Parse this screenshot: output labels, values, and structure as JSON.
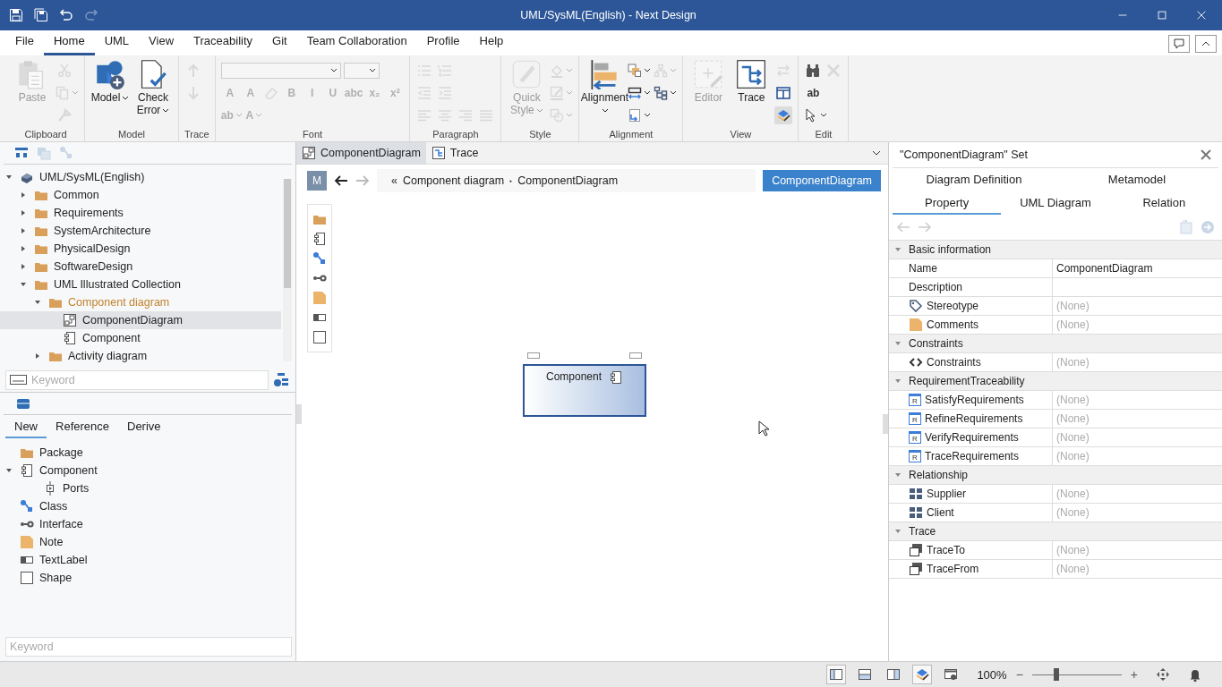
{
  "window": {
    "title": "UML/SysML(English) - Next Design"
  },
  "menu": [
    {
      "label": "File",
      "selected": false
    },
    {
      "label": "Home",
      "selected": true
    },
    {
      "label": "UML",
      "selected": false
    },
    {
      "label": "View",
      "selected": false
    },
    {
      "label": "Traceability",
      "selected": false
    },
    {
      "label": "Git",
      "selected": false
    },
    {
      "label": "Team Collaboration",
      "selected": false
    },
    {
      "label": "Profile",
      "selected": false
    },
    {
      "label": "Help",
      "selected": false
    }
  ],
  "ribbon": [
    {
      "label": "Clipboard",
      "large": [
        {
          "label": "Paste",
          "kind": "paste",
          "disabled": true,
          "menu": false
        }
      ],
      "rows": [
        [
          {
            "kind": "scissors",
            "disabled": true,
            "menu": false
          }
        ],
        [
          {
            "kind": "copy",
            "disabled": true,
            "menu": true
          }
        ],
        [
          {
            "kind": "brush",
            "disabled": true,
            "menu": false
          }
        ]
      ]
    },
    {
      "label": "Model",
      "large": [
        {
          "label": "Model",
          "kind": "model",
          "disabled": false,
          "menu": true
        },
        {
          "label": "Check Error",
          "kind": "check",
          "disabled": false,
          "menu": true
        }
      ]
    },
    {
      "label": "Trace",
      "rows": [
        [
          {
            "kind": "arrow-up",
            "disabled": true,
            "menu": false
          }
        ],
        [
          {
            "kind": "arrow-down",
            "disabled": true,
            "menu": false
          }
        ]
      ]
    },
    {
      "label": "Font",
      "rows": [
        [
          {
            "kind": "font-name-dropdown",
            "disabled": true,
            "menu": true
          },
          {
            "kind": "font-size-dropdown",
            "disabled": true,
            "menu": true
          }
        ],
        [
          {
            "kind": "grow",
            "glyph": "A",
            "disabled": true,
            "menu": false
          },
          {
            "kind": "shrink",
            "glyph": "A",
            "disabled": true,
            "menu": false
          },
          {
            "kind": "eraser",
            "disabled": true,
            "menu": false
          },
          {
            "kind": "bold",
            "glyph": "B",
            "disabled": true,
            "menu": false
          },
          {
            "kind": "italic",
            "glyph": "I",
            "disabled": true,
            "menu": false
          },
          {
            "kind": "underline",
            "glyph": "U",
            "disabled": true,
            "menu": false
          },
          {
            "kind": "strike",
            "glyph": "abc",
            "disabled": true,
            "menu": false
          },
          {
            "kind": "subscript",
            "glyph": "x₂",
            "disabled": true,
            "menu": false
          },
          {
            "kind": "superscript",
            "glyph": "x²",
            "disabled": true,
            "menu": false
          }
        ],
        [
          {
            "kind": "highlight",
            "glyph": "ab",
            "disabled": true,
            "menu": true
          },
          {
            "kind": "font-color",
            "glyph": "A",
            "disabled": true,
            "menu": true
          }
        ]
      ]
    },
    {
      "label": "Paragraph",
      "rows": [
        [
          {
            "kind": "bullets",
            "disabled": true,
            "menu": false
          },
          {
            "kind": "numbering",
            "disabled": true,
            "menu": false
          }
        ],
        [
          {
            "kind": "outdent",
            "disabled": true,
            "menu": false
          },
          {
            "kind": "indent",
            "disabled": true,
            "menu": false
          }
        ],
        [
          {
            "kind": "align-left",
            "disabled": true,
            "menu": false
          },
          {
            "kind": "align-center",
            "disabled": true,
            "menu": false
          },
          {
            "kind": "align-right",
            "disabled": true,
            "menu": false
          },
          {
            "kind": "justify",
            "disabled": true,
            "menu": false
          }
        ]
      ]
    },
    {
      "label": "Style",
      "large": [
        {
          "label": "Quick Style",
          "kind": "quick-style",
          "disabled": true,
          "menu": true
        }
      ],
      "rows": [
        [
          {
            "kind": "fill",
            "disabled": true,
            "menu": true
          }
        ],
        [
          {
            "kind": "pen",
            "disabled": true,
            "menu": true
          }
        ],
        [
          {
            "kind": "shapes",
            "disabled": true,
            "menu": true
          }
        ]
      ]
    },
    {
      "label": "Alignment",
      "large": [
        {
          "label": "Alignment",
          "kind": "alignment",
          "disabled": false,
          "menu": true
        }
      ],
      "rows": [
        [
          {
            "kind": "order",
            "disabled": false,
            "menu": true
          },
          {
            "kind": "hierarchy",
            "disabled": true,
            "menu": true
          }
        ],
        [
          {
            "kind": "spacing",
            "disabled": false,
            "menu": true
          },
          {
            "kind": "tree-layout",
            "disabled": false,
            "menu": true
          }
        ],
        [
          {
            "kind": "size",
            "disabled": false,
            "menu": true
          }
        ]
      ]
    },
    {
      "label": "View",
      "large": [
        {
          "label": "Editor",
          "kind": "editor",
          "disabled": true,
          "menu": false
        },
        {
          "label": "Trace",
          "kind": "trace",
          "disabled": false,
          "menu": false
        }
      ],
      "rows": [
        [
          {
            "kind": "swap",
            "disabled": true,
            "menu": false
          }
        ],
        [
          {
            "kind": "split",
            "disabled": false,
            "menu": false
          }
        ],
        [
          {
            "kind": "highlighter",
            "disabled": false,
            "menu": false,
            "selected": true
          }
        ]
      ]
    },
    {
      "label": "Edit",
      "rows": [
        [
          {
            "kind": "binoculars",
            "disabled": false,
            "menu": false
          },
          {
            "kind": "cross",
            "disabled": true,
            "menu": false
          }
        ],
        [
          {
            "kind": "replace",
            "glyph": "ab",
            "disabled": false,
            "menu": false
          }
        ],
        [
          {
            "kind": "cursor",
            "disabled": false,
            "menu": true
          }
        ]
      ]
    }
  ],
  "model_panel": {
    "tree": [
      {
        "label": "UML/SysML(English)",
        "kind": "model",
        "expanded": true,
        "highlighted": false,
        "selected": false,
        "children": [
          {
            "label": "Common",
            "kind": "folder",
            "expanded": false,
            "highlighted": false,
            "selected": false
          },
          {
            "label": "Requirements",
            "kind": "folder",
            "expanded": false,
            "highlighted": false,
            "selected": false
          },
          {
            "label": "SystemArchitecture",
            "kind": "folder",
            "expanded": false,
            "highlighted": false,
            "selected": false
          },
          {
            "label": "PhysicalDesign",
            "kind": "folder",
            "expanded": false,
            "highlighted": false,
            "selected": false
          },
          {
            "label": "SoftwareDesign",
            "kind": "folder",
            "expanded": false,
            "highlighted": false,
            "selected": false
          },
          {
            "label": "UML Illustrated Collection",
            "kind": "folder",
            "expanded": true,
            "highlighted": false,
            "selected": false,
            "children": [
              {
                "label": "Component diagram",
                "kind": "folder",
                "expanded": true,
                "highlighted": true,
                "selected": false,
                "children": [
                  {
                    "label": "ComponentDiagram",
                    "kind": "diagram",
                    "highlighted": false,
                    "selected": true
                  },
                  {
                    "label": "Component",
                    "kind": "component",
                    "highlighted": false,
                    "selected": false
                  }
                ]
              },
              {
                "label": "Activity diagram",
                "kind": "folder",
                "expanded": false,
                "highlighted": false,
                "selected": false
              }
            ]
          }
        ]
      }
    ],
    "search": {
      "placeholder": "Keyword"
    }
  },
  "toolbox": {
    "tabs": [
      {
        "label": "New",
        "selected": true
      },
      {
        "label": "Reference",
        "selected": false
      },
      {
        "label": "Derive",
        "selected": false
      }
    ],
    "items": [
      {
        "label": "Package",
        "kind": "folder"
      },
      {
        "label": "Component",
        "kind": "component",
        "expanded": true,
        "children": [
          {
            "label": "Ports",
            "kind": "ports"
          }
        ]
      },
      {
        "label": "Class",
        "kind": "class"
      },
      {
        "label": "Interface",
        "kind": "interface"
      },
      {
        "label": "Note",
        "kind": "note"
      },
      {
        "label": "TextLabel",
        "kind": "textlabel"
      },
      {
        "label": "Shape",
        "kind": "shape"
      }
    ],
    "search": {
      "placeholder": "Keyword"
    }
  },
  "editor": {
    "tabs": [
      {
        "label": "ComponentDiagram",
        "kind": "diagram",
        "selected": true
      },
      {
        "label": "Trace",
        "kind": "trace",
        "selected": false
      }
    ],
    "badge": "M",
    "breadcrumb": {
      "prefix": "«",
      "separator": "‣",
      "items": [
        "Component diagram",
        "ComponentDiagram"
      ]
    },
    "mode_button": "ComponentDiagram",
    "nodes": [
      {
        "label": "Component",
        "selected": true
      }
    ]
  },
  "properties": {
    "title": "\"ComponentDiagram\" Set",
    "tabs_top": [
      {
        "label": "Diagram Definition",
        "selected": false
      },
      {
        "label": "Metamodel",
        "selected": false
      }
    ],
    "tabs": [
      {
        "label": "Property",
        "selected": true
      },
      {
        "label": "UML Diagram",
        "selected": false
      },
      {
        "label": "Relation",
        "selected": false
      }
    ],
    "sections": [
      {
        "title": "Basic information",
        "expanded": true,
        "rows": [
          {
            "name": "Name",
            "value": "ComponentDiagram",
            "unset": false
          },
          {
            "name": "Description"
          },
          {
            "name": "Stereotype",
            "kind": "tag",
            "value": "(None)",
            "unset": true
          },
          {
            "name": "Comments",
            "kind": "note",
            "value": "(None)",
            "unset": true
          }
        ]
      },
      {
        "title": "Constraints",
        "expanded": true,
        "rows": [
          {
            "name": "Constraints",
            "kind": "code",
            "value": "(None)",
            "unset": true
          }
        ]
      },
      {
        "title": "RequirementTraceability",
        "expanded": true,
        "rows": [
          {
            "name": "SatisfyRequirements",
            "kind": "req",
            "icon_text": "R",
            "value": "(None)",
            "unset": true
          },
          {
            "name": "RefineRequirements",
            "kind": "req",
            "icon_text": "R",
            "value": "(None)",
            "unset": true
          },
          {
            "name": "VerifyRequirements",
            "kind": "req",
            "icon_text": "R",
            "value": "(None)",
            "unset": true
          },
          {
            "name": "TraceRequirements",
            "kind": "req",
            "icon_text": "R",
            "value": "(None)",
            "unset": true
          }
        ]
      },
      {
        "title": "Relationship",
        "expanded": true,
        "rows": [
          {
            "name": "Supplier",
            "kind": "grid",
            "value": "(None)",
            "unset": true
          },
          {
            "name": "Client",
            "kind": "grid",
            "value": "(None)",
            "unset": true
          }
        ]
      },
      {
        "title": "Trace",
        "expanded": true,
        "rows": [
          {
            "name": "TraceTo",
            "kind": "boxes",
            "value": "(None)",
            "unset": true
          },
          {
            "name": "TraceFrom",
            "kind": "boxes",
            "value": "(None)",
            "unset": true
          }
        ]
      }
    ]
  },
  "status": {
    "layouts": [
      {
        "kind": "left-pane",
        "selected": true
      },
      {
        "kind": "bottom-pane",
        "selected": false
      },
      {
        "kind": "right-pane",
        "selected": false
      },
      {
        "kind": "highlighter",
        "selected": true
      },
      {
        "kind": "window-gear",
        "selected": false
      }
    ],
    "zoom": "100%",
    "zoom_out": "−",
    "zoom_in": "+",
    "zoom_slider": {
      "level": 0.27
    }
  }
}
